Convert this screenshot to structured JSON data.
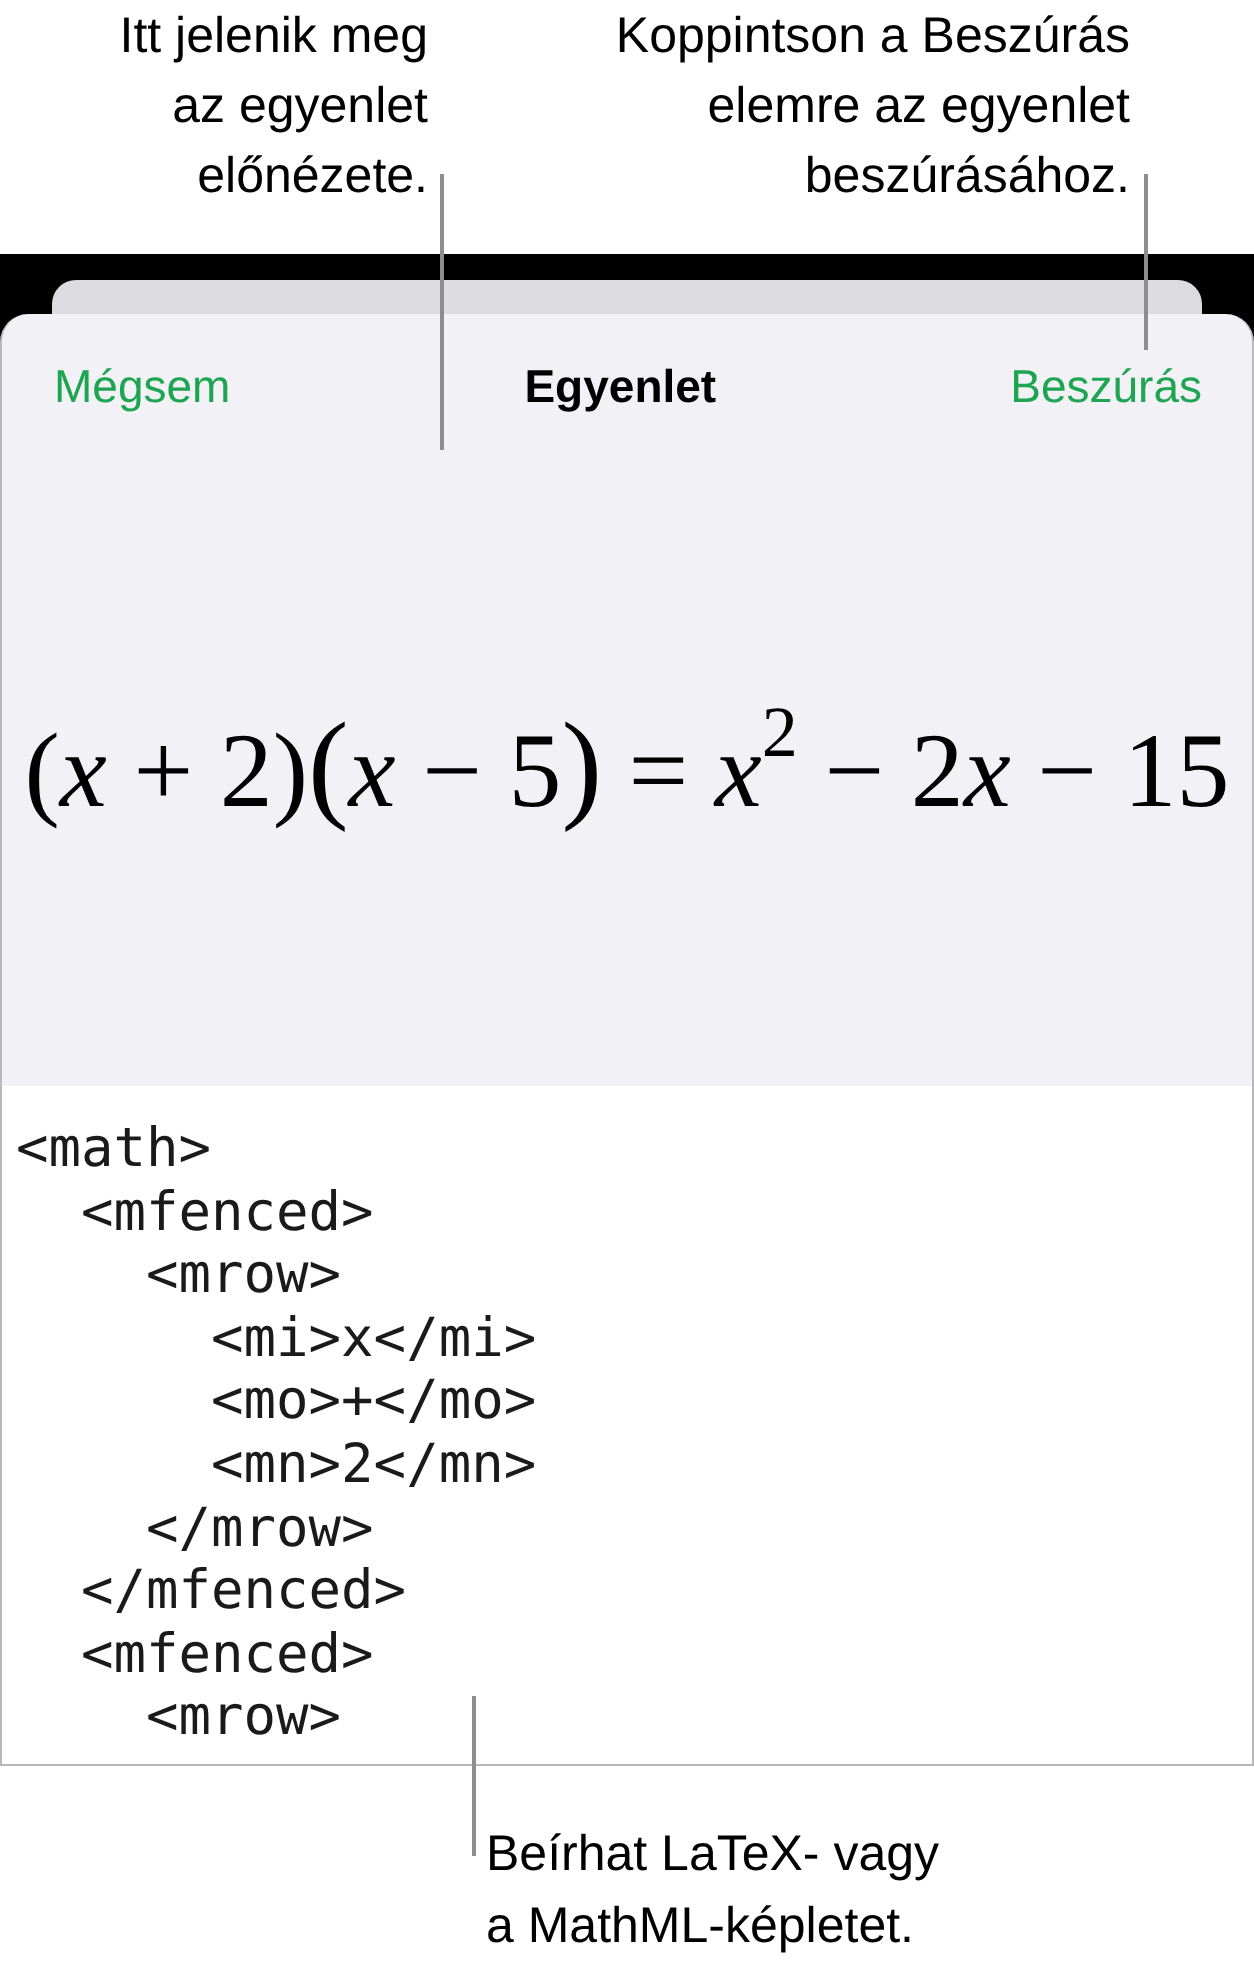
{
  "callouts_top": [
    {
      "lines": [
        "Itt jelenik meg",
        "az egyenlet",
        "előnézete."
      ]
    },
    {
      "lines": [
        "Koppintson a Beszúrás",
        "elemre az egyenlet",
        "beszúrásához."
      ]
    }
  ],
  "sheet": {
    "cancel_button": "Mégsem",
    "title": "Egyenlet",
    "insert_button": "Beszúrás",
    "equation": [
      {
        "kind": "fence",
        "text": "("
      },
      {
        "kind": "var",
        "text": "x"
      },
      {
        "kind": "op",
        "text": "+"
      },
      {
        "kind": "num",
        "text": "2"
      },
      {
        "kind": "fence",
        "text": ")"
      },
      {
        "kind": "fence_large",
        "text": "("
      },
      {
        "kind": "var",
        "text": "x"
      },
      {
        "kind": "op",
        "text": "−"
      },
      {
        "kind": "num",
        "text": "5"
      },
      {
        "kind": "fence_large",
        "text": ")"
      },
      {
        "kind": "op",
        "text": "="
      },
      {
        "kind": "var",
        "text": "x"
      },
      {
        "kind": "sup",
        "text": "2"
      },
      {
        "kind": "op",
        "text": "−"
      },
      {
        "kind": "num",
        "text": "2"
      },
      {
        "kind": "var",
        "text": "x"
      },
      {
        "kind": "op",
        "text": "−"
      },
      {
        "kind": "num",
        "text": "15"
      }
    ],
    "editor": {
      "value": "<math>\n  <mfenced>\n    <mrow>\n      <mi>x</mi>\n      <mo>+</mo>\n      <mn>2</mn>\n    </mrow>\n  </mfenced>\n  <mfenced>\n    <mrow>"
    }
  },
  "callout_bottom": {
    "lines": [
      "Beírhat LaTeX- vagy",
      "a MathML-képletet."
    ]
  }
}
